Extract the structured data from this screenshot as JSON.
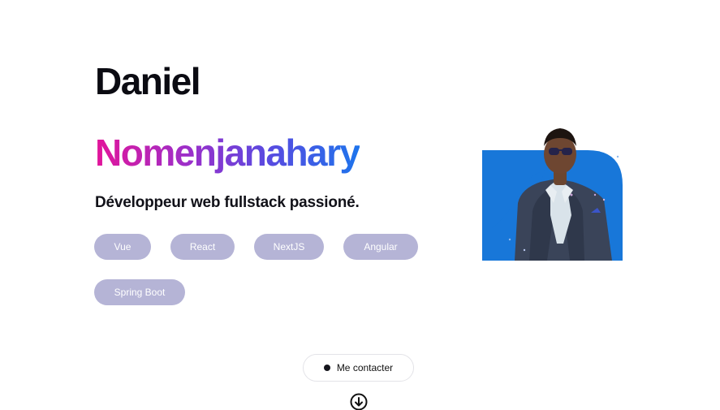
{
  "hero": {
    "first_name": "Daniel",
    "last_name": "Nomenjanahary",
    "tagline": "Développeur web fullstack passioné.",
    "skills": [
      "Vue",
      "React",
      "NextJS",
      "Angular",
      "Spring Boot"
    ]
  },
  "contact": {
    "button_label": "Me contacter"
  },
  "icons": {
    "contact_dot": "dot-icon",
    "scroll": "arrow-down-circle-icon"
  },
  "colors": {
    "name_gradient": [
      "#e3159a",
      "#9c2fc9",
      "#5a4ae0",
      "#1d74ec"
    ],
    "chip_bg": "#b5b4d6",
    "photo_bg_blue": "#1877d9"
  }
}
